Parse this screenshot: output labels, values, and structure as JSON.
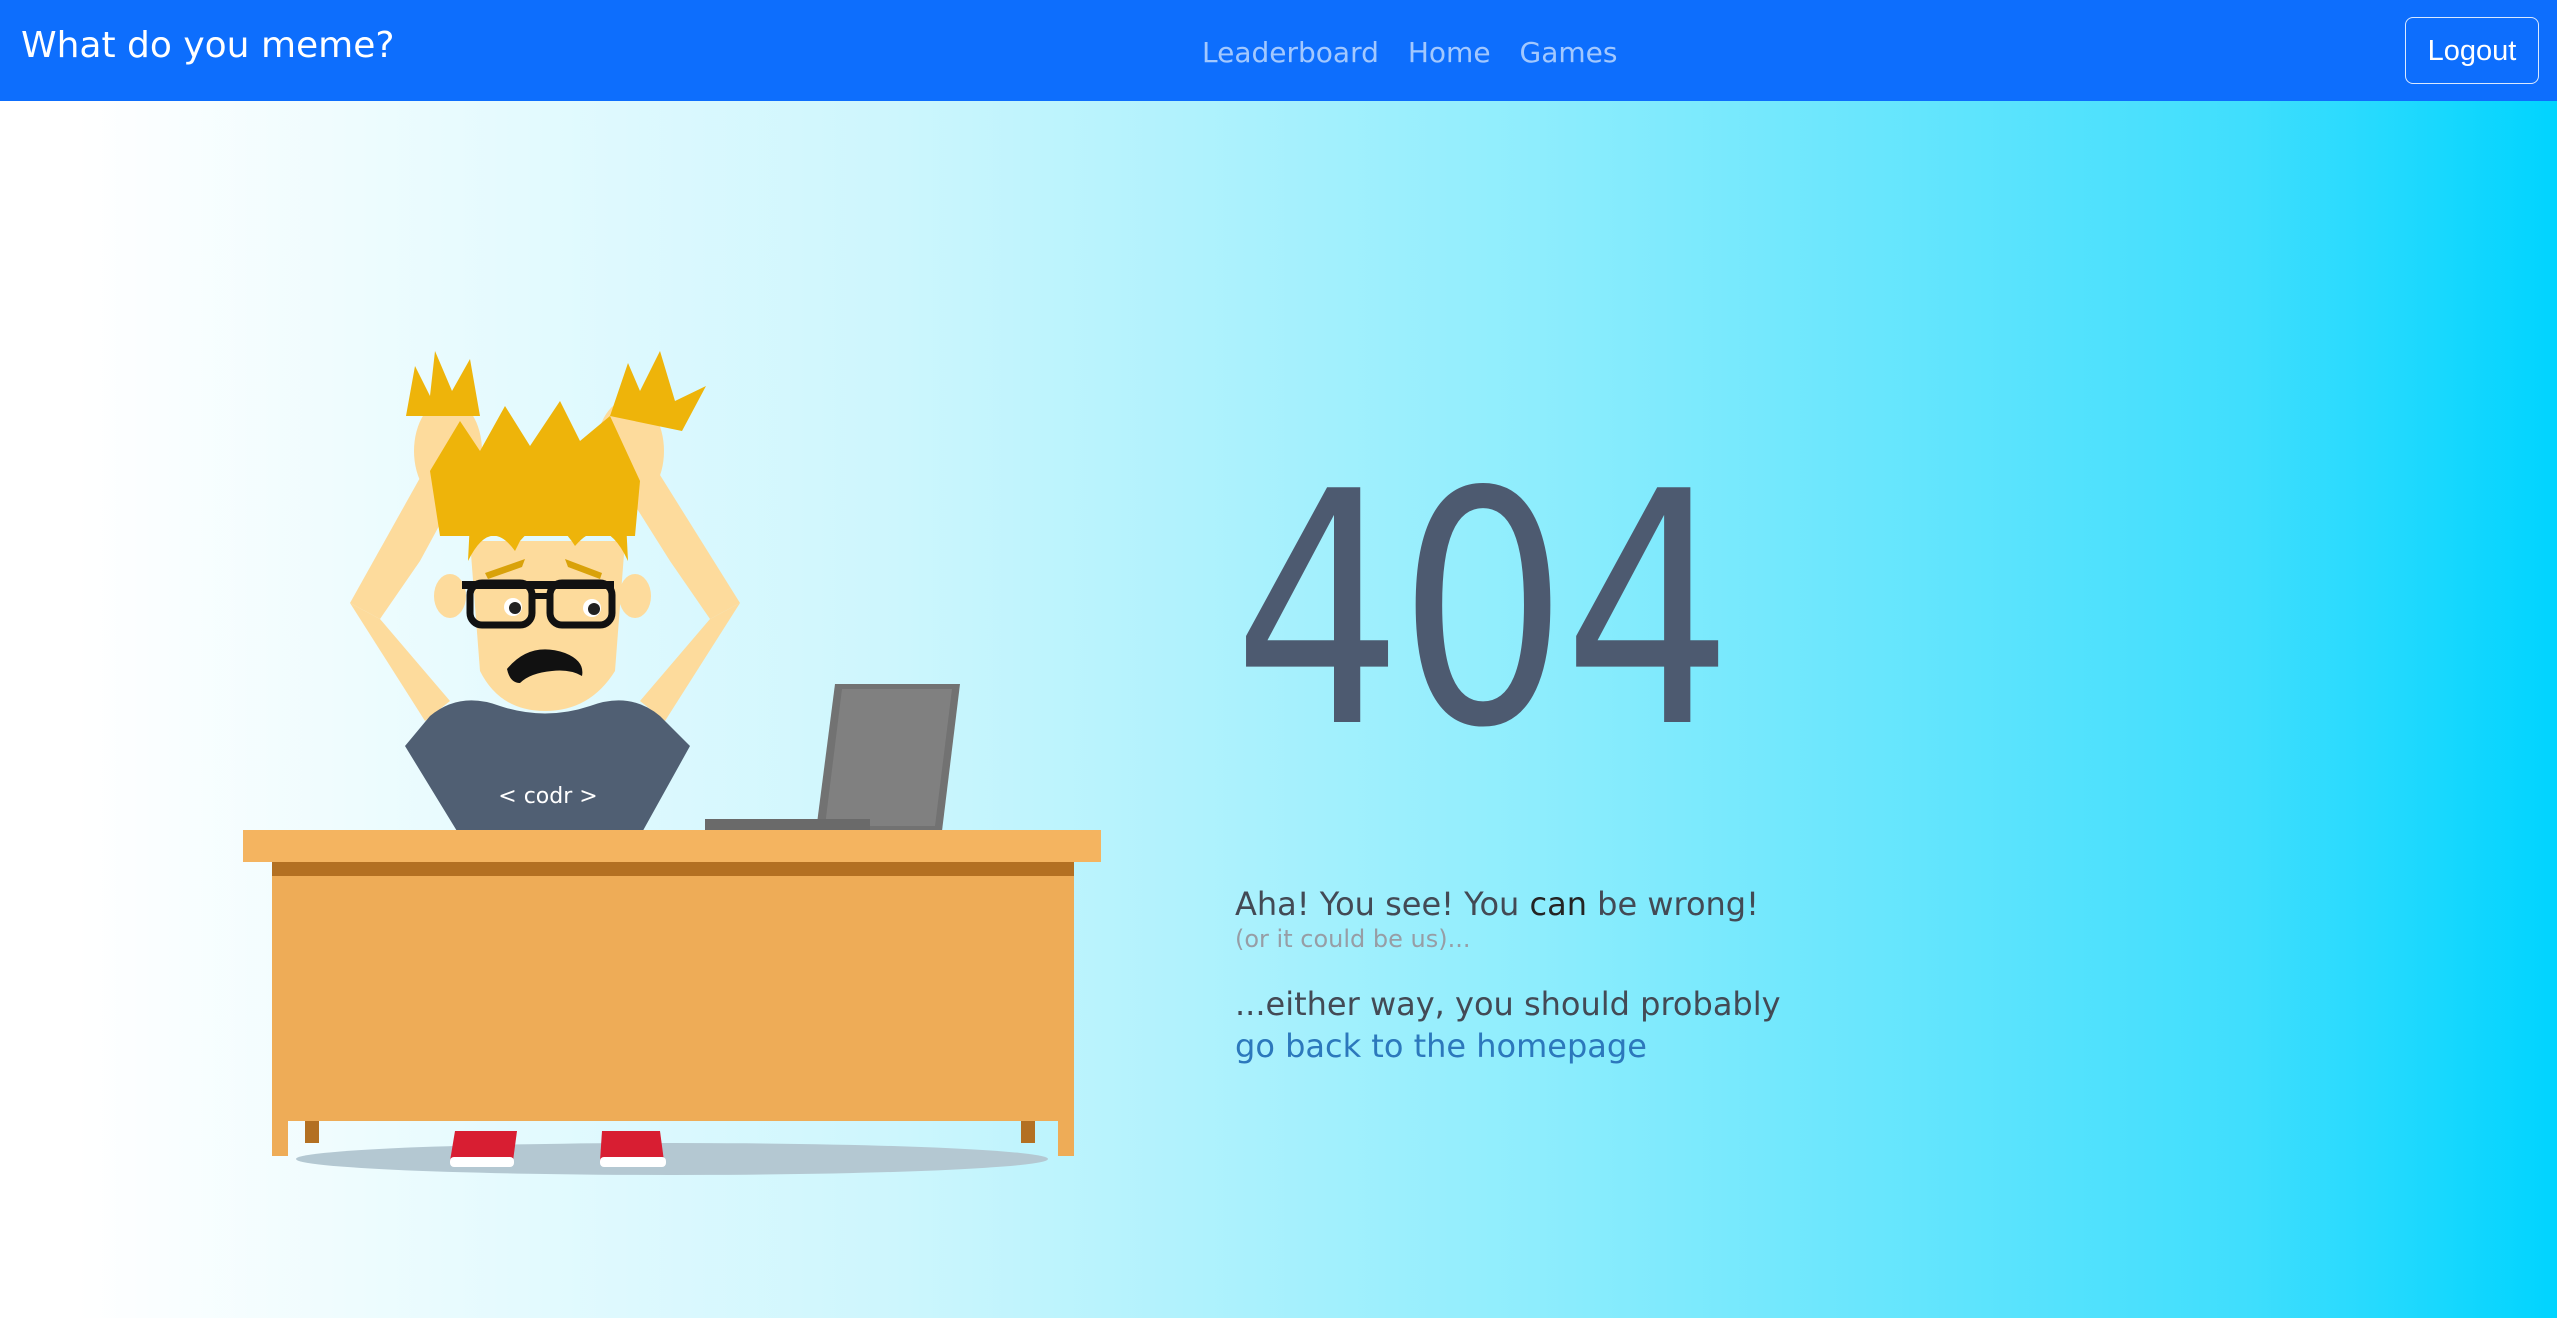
{
  "navbar": {
    "brand": "What do you meme?",
    "links": [
      {
        "label": "Leaderboard"
      },
      {
        "label": "Home"
      },
      {
        "label": "Games"
      }
    ],
    "logout_label": "Logout",
    "background": "#0d6efd"
  },
  "error": {
    "code": "404",
    "line1_part1": "Aha! You see! You ",
    "line1_emphasis": "can",
    "line1_part2": " be wrong!",
    "subline": "(or it could be us)...",
    "either_text": "...either way, you should probably",
    "home_link": "go back to the homepage"
  },
  "illustration": {
    "shirt_text": "< codr >"
  },
  "colors": {
    "accent": "#0d6efd",
    "code_color": "#4d5a70",
    "link_color": "#2c78bc"
  }
}
